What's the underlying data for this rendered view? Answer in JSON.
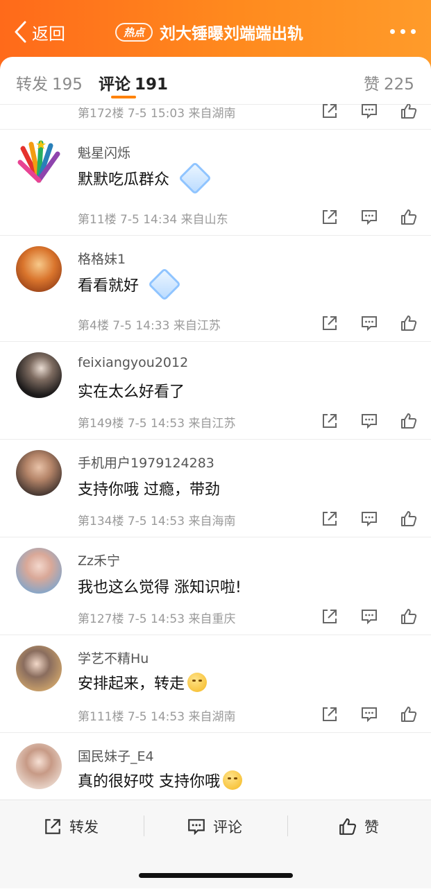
{
  "header": {
    "back_label": "返回",
    "hot_badge": "热点",
    "title": "刘大锤曝刘端端出轨"
  },
  "tabs": [
    {
      "label": "转发",
      "count": "195"
    },
    {
      "label": "评论",
      "count": "191"
    },
    {
      "label": "赞",
      "count": "225"
    }
  ],
  "comments": [
    {
      "username": "",
      "text": "",
      "floor": "第172楼",
      "date": "7-5",
      "time": "15:03",
      "location": "来自湖南"
    },
    {
      "username": "魁星闪烁",
      "text": "默默吃瓜群众",
      "floor": "第11楼",
      "date": "7-5",
      "time": "14:34",
      "location": "来自山东"
    },
    {
      "username": "格格妹1",
      "text": "看看就好",
      "floor": "第4楼",
      "date": "7-5",
      "time": "14:33",
      "location": "来自江苏"
    },
    {
      "username": "feixiangyou2012",
      "text": "实在太么好看了",
      "floor": "第149楼",
      "date": "7-5",
      "time": "14:53",
      "location": "来自江苏"
    },
    {
      "username": "手机用户1979124283",
      "text": "支持你哦 过瘾，带劲",
      "floor": "第134楼",
      "date": "7-5",
      "time": "14:53",
      "location": "来自海南"
    },
    {
      "username": "Zz禾宁",
      "text": "我也这么觉得 涨知识啦!",
      "floor": "第127楼",
      "date": "7-5",
      "time": "14:53",
      "location": "来自重庆"
    },
    {
      "username": "学艺不精Hu",
      "text": "安排起来，转走",
      "floor": "第111楼",
      "date": "7-5",
      "time": "14:53",
      "location": "来自湖南"
    },
    {
      "username": "国民妹子_E4",
      "text": "真的很好哎 支持你哦",
      "floor": "",
      "date": "",
      "time": "",
      "location": ""
    }
  ],
  "bottom_bar": {
    "repost_label": "转发",
    "comment_label": "评论",
    "like_label": "赞"
  },
  "colors": {
    "accent": "#ff8200",
    "header_gradient_start": "#ff6a1a",
    "header_gradient_end": "#ff9b2a"
  }
}
